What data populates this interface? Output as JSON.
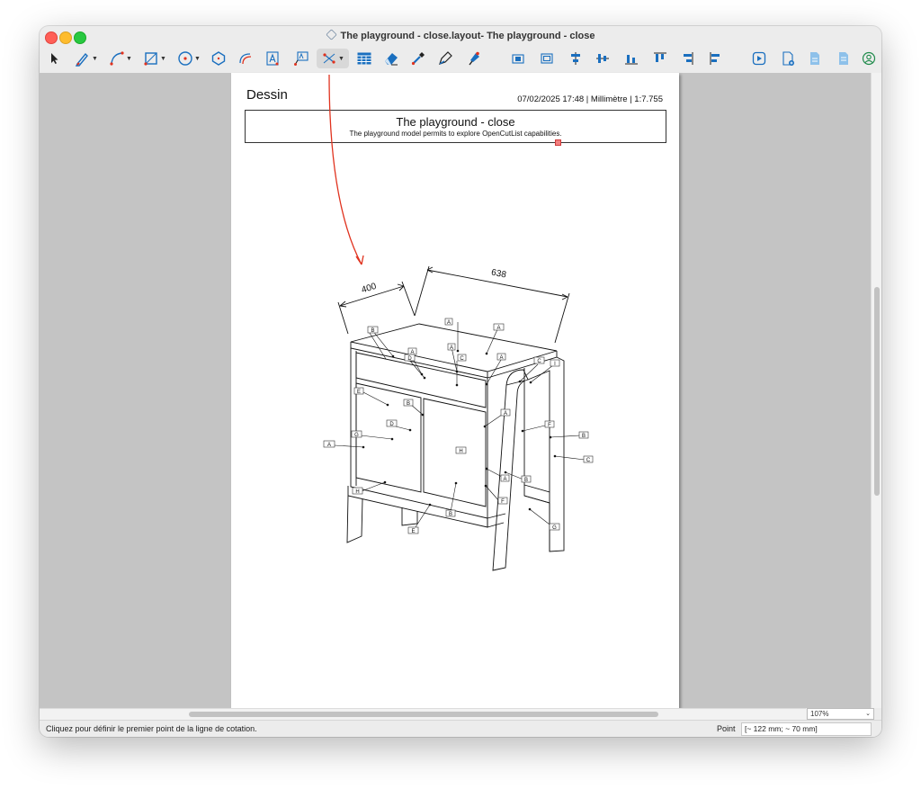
{
  "window": {
    "title": "The playground - close.layout- The playground - close"
  },
  "toolbar": {
    "tools": [
      {
        "name": "select-tool-icon"
      },
      {
        "name": "freehand-tool-icon"
      },
      {
        "name": "arc-tool-icon"
      },
      {
        "name": "rectangle-tool-icon"
      },
      {
        "name": "circle-tool-icon"
      },
      {
        "name": "polygon-tool-icon"
      },
      {
        "name": "offset-tool-icon"
      },
      {
        "name": "text-tool-icon"
      },
      {
        "name": "label-tool-icon"
      },
      {
        "name": "dimension-tool-icon"
      },
      {
        "name": "table-tool-icon"
      },
      {
        "name": "eraser-tool-icon"
      },
      {
        "name": "eyedropper-tool-icon"
      },
      {
        "name": "style-tool-icon"
      },
      {
        "name": "pin-tool-icon"
      }
    ]
  },
  "page": {
    "heading": "Dessin",
    "meta": "07/02/2025 17:48  |  Millimètre  |  1:7.755",
    "title": "The playground - close",
    "subtitle": "The playground model permits to explore OpenCutList capabilities."
  },
  "drawing": {
    "dimensions": [
      "400",
      "638"
    ],
    "labels": [
      "A",
      "B",
      "C",
      "D",
      "E",
      "F",
      "G",
      "H",
      "I"
    ]
  },
  "zoom": {
    "value": "107%"
  },
  "status": {
    "hint": "Cliquez pour définir le premier point de la ligne de cotation.",
    "point_label": "Point",
    "point_value": "[~ 122 mm; ~ 70 mm]"
  },
  "colors": {
    "accent": "#e0321e",
    "tool_blue": "#1a6fbf",
    "canvas": "#c4c4c4"
  }
}
